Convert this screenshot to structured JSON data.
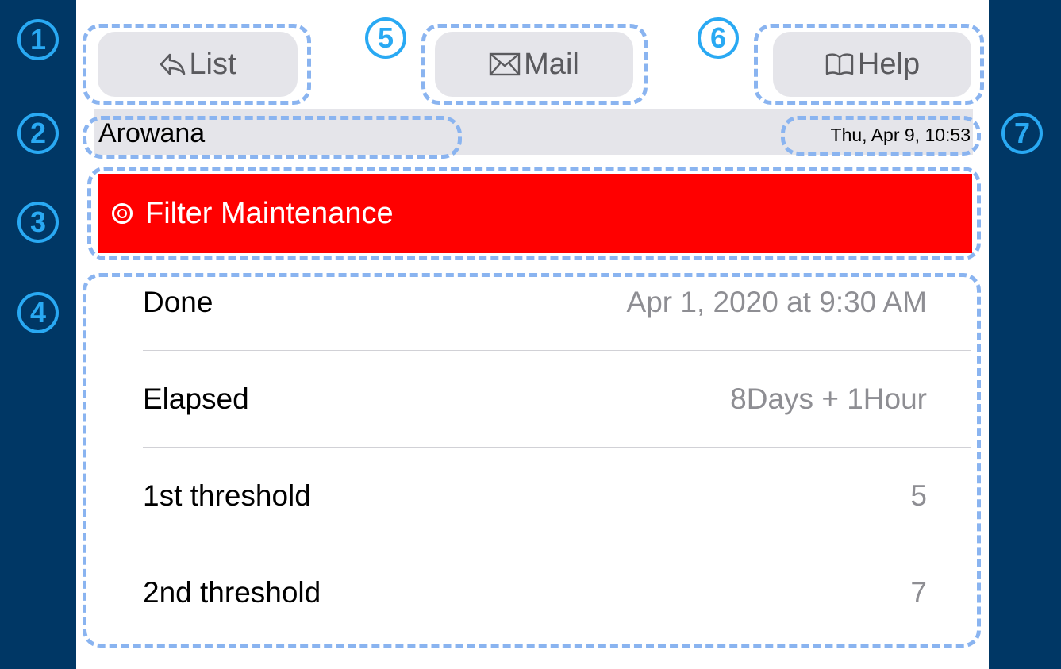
{
  "toolbar": {
    "list_label": "List",
    "mail_label": "Mail",
    "help_label": "Help"
  },
  "header": {
    "name": "Arowana",
    "datetime": "Thu, Apr 9, 10:53"
  },
  "banner": {
    "title": "Filter Maintenance",
    "color": "#ff0000"
  },
  "rows": [
    {
      "label": "Done",
      "value": "Apr 1, 2020 at 9:30 AM"
    },
    {
      "label": "Elapsed",
      "value": "8Days + 1Hour"
    },
    {
      "label": "1st threshold",
      "value": "5"
    },
    {
      "label": "2nd threshold",
      "value": "7"
    }
  ],
  "annotations": {
    "n1": "1",
    "n2": "2",
    "n3": "3",
    "n4": "4",
    "n5": "5",
    "n6": "6",
    "n7": "7"
  },
  "colors": {
    "background": "#003765",
    "callout": "#8ab4f0",
    "badge": "#29a9f3"
  }
}
